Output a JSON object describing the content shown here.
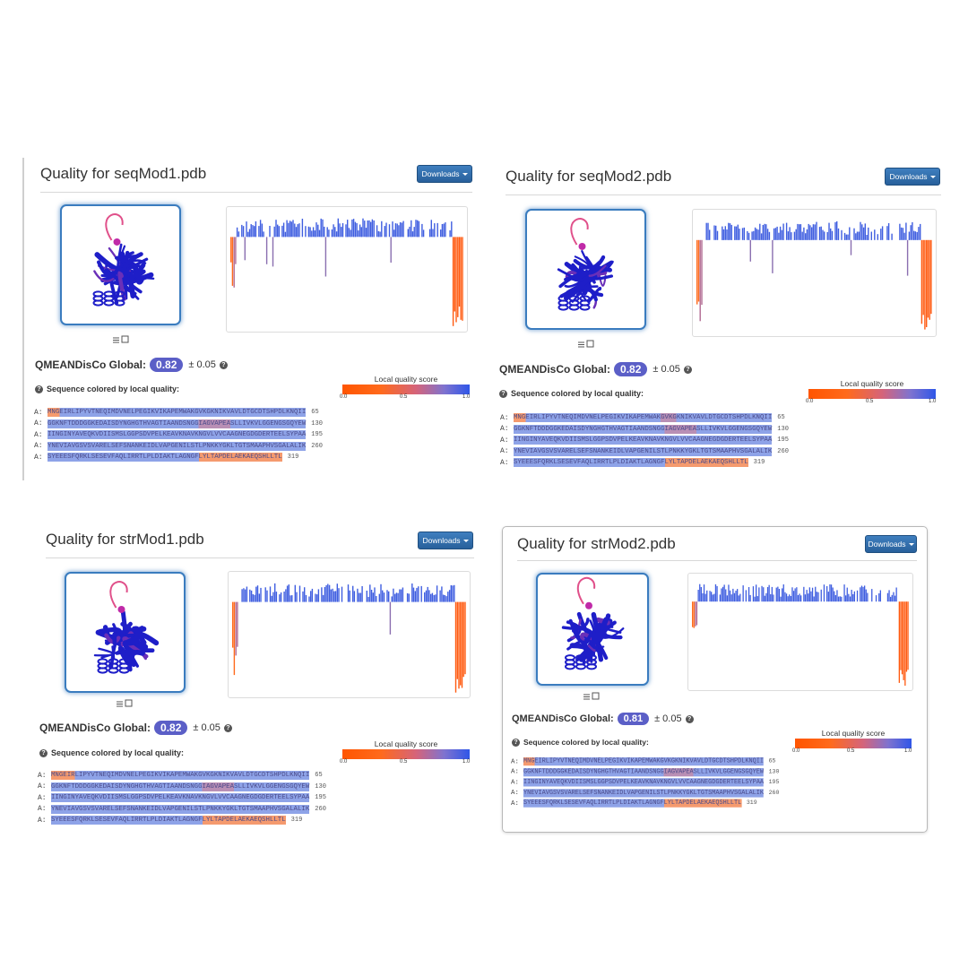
{
  "colors": {
    "accent": "#3a7cbf",
    "badge": "#5b5fc7",
    "low_quality": "#ff6a1c",
    "high_quality": "#4a6ae0"
  },
  "icons": {
    "viewer_icons": "list-and-checkbox-icon",
    "help": "question-circle-icon",
    "caret": "caret-down-icon"
  },
  "common": {
    "downloads_label": "Downloads",
    "global_label": "QMEANDisCo Global:",
    "seq_label": "Sequence colored by local quality:",
    "legend_title": "Local quality score",
    "legend_ticks": [
      "0.0",
      "0.5",
      "1.0"
    ],
    "chain_label": "A:",
    "line_numbers": [
      "65",
      "130",
      "195",
      "260",
      "319"
    ],
    "sequence_lines": [
      "MNGEIRLIPYVTNEQIMDVNELPEGIKVIKAPEMWAKGVKGKNIKVAVLDTGCDTSHPDLKNQII",
      "GGKNFTDDDGGKEDAISDYNGHGTHVAGTIAANDSNGGIAGVAPEASLLIVKVLGGENGSGQYEW",
      "IINGINYAVEQKVDIISMSLGGPSDVPELKEAVKNAVKNGVLVVCAAGNEGDGDERTEELSYPAA",
      "YNEVIAVGSVSVARELSEFSNANKEIDLVAPGENILSTLPNKKYGKLTGTSMAAPHVSGALALIK",
      "SYEEESFQRKLSESEVFAQLIRRTLPLDIAKTLAGNGFLYLTAPDELAEKAEQSHLLTL"
    ]
  },
  "panels": [
    {
      "title": "Quality for seqMod1.pdb",
      "global_score": "0.82",
      "error": "± 0.05"
    },
    {
      "title": "Quality for seqMod2.pdb",
      "global_score": "0.82",
      "error": "± 0.05"
    },
    {
      "title": "Quality for strMod1.pdb",
      "global_score": "0.82",
      "error": "± 0.05"
    },
    {
      "title": "Quality for strMod2.pdb",
      "global_score": "0.81",
      "error": "± 0.05"
    }
  ]
}
